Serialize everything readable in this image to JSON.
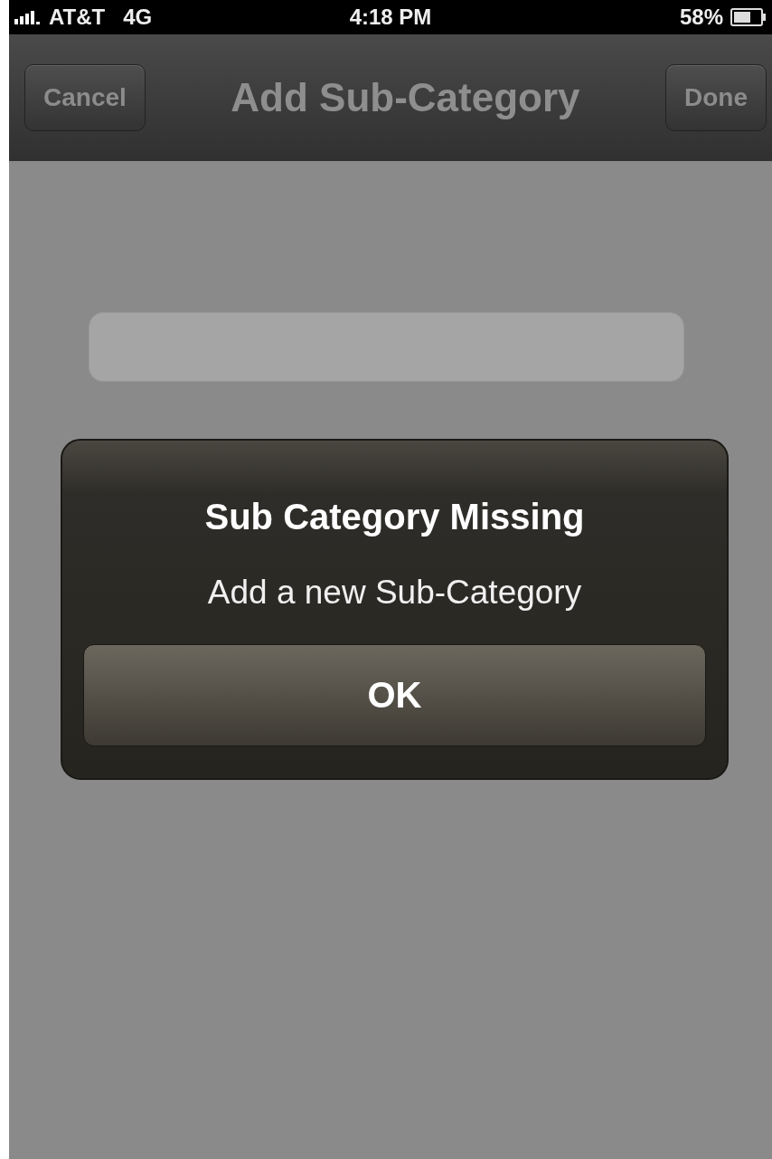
{
  "status_bar": {
    "carrier": "AT&T",
    "network": "4G",
    "time": "4:18 PM",
    "battery": "58%"
  },
  "nav_bar": {
    "title": "Add Sub-Category",
    "left_button": "Cancel",
    "right_button": "Done"
  },
  "alert": {
    "title": "Sub Category Missing",
    "message": "Add a new Sub-Category",
    "buttons": [
      "OK"
    ]
  }
}
